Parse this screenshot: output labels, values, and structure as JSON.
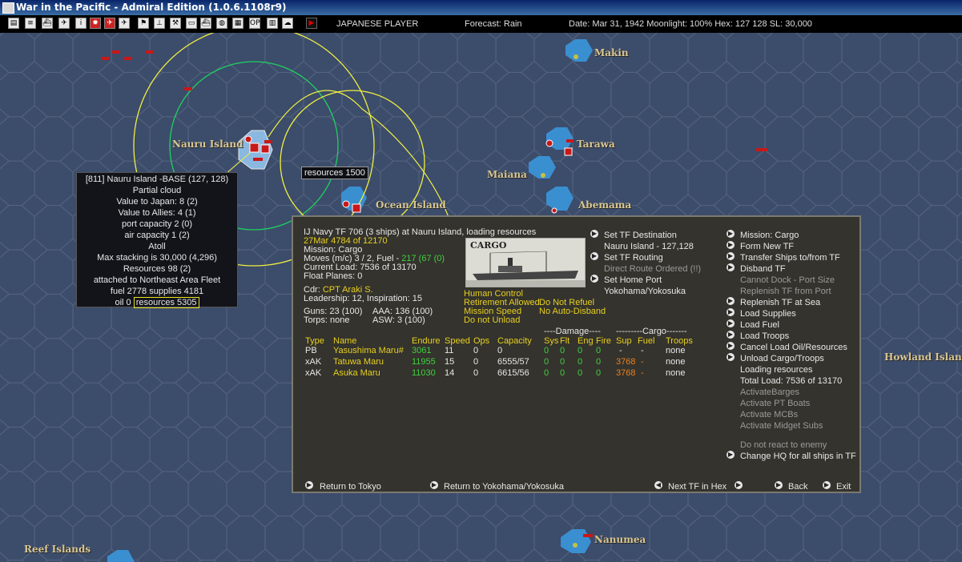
{
  "window": {
    "title": "War in the Pacific - Admiral Edition (1.0.6.1108r9)"
  },
  "toolbar": {
    "player": "JAPANESE PLAYER",
    "forecast": "Forecast: Rain",
    "status": "Date: Mar 31, 1942   Moonlight: 100%  Hex: 127 128  SL: 30,000",
    "op_label": "OP"
  },
  "map": {
    "labels": {
      "makin": "Makin",
      "nauru": "Nauru Island",
      "tarawa": "Tarawa",
      "maiana": "Maiana",
      "ocean": "Ocean Island",
      "abemama": "Abemama",
      "howland": "Howland Island",
      "nanumea": "Nanumea",
      "reef": "Reef Islands"
    },
    "tooltip": "resources 1500"
  },
  "base_popup": {
    "lines": [
      "[811] Nauru Island  -BASE  (127, 128)",
      "Partial cloud",
      "Value to Japan:  8 (2)",
      "Value to Allies:  4 (1)",
      "port capacity  2 (0)",
      "air capacity  1 (2)",
      "Atoll",
      "Max stacking is 30,000  (4,296)",
      "Resources   98 (2)",
      "attached to Northeast Area Fleet",
      "fuel 2778  supplies 4181"
    ],
    "oil": "oil 0",
    "resources": "resources 5305"
  },
  "tf_panel": {
    "header": "IJ Navy TF 706 (3 ships) at Nauru Island, loading resources",
    "date_line": "27Mar 4784 of 12170",
    "mission": "Mission: Cargo",
    "moves_prefix": "Moves (m/c)  3 / 2, Fuel - ",
    "moves_fuel": "217 (67 (0)",
    "current_load": "Current Load: 7536 of 13170",
    "float_planes": "Float Planes: 0",
    "cdr_label": "Cdr:",
    "cdr_name": "CPT Araki S.",
    "leadership": "Leadership: 12, Inspiration: 15",
    "guns": "Guns: 23 (100)",
    "aaa": "AAA: 136 (100)",
    "torps": "Torps: none",
    "asw": "ASW: 3 (100)",
    "ship_class": "CARGO",
    "status": {
      "human_control": "Human Control",
      "retirement": "Retirement Allowed",
      "no_refuel": "Do Not Refuel",
      "mission_speed": "Mission Speed",
      "no_disband": "No Auto-Disband",
      "no_unload": "Do not Unload"
    },
    "headers": {
      "damage_group": "----Damage----",
      "cargo_group": "---------Cargo-------",
      "type": "Type",
      "name": "Name",
      "endure": "Endure",
      "speed": "Speed",
      "ops": "Ops",
      "capacity": "Capacity",
      "sys": "Sys",
      "flt": "Flt",
      "eng": "Eng",
      "fire": "Fire",
      "sup": "Sup",
      "fuel": "Fuel",
      "troops": "Troops"
    },
    "ships": [
      {
        "type": "PB",
        "name": "Yasushima Maru#",
        "endure": "3061",
        "speed": "11",
        "ops": "0",
        "capacity": "0",
        "sys": "0",
        "flt": "0",
        "eng": "0",
        "fire": "0",
        "sup": "-",
        "fuel": "-",
        "troops": "none"
      },
      {
        "type": "xAK",
        "name": "Tatuwa Maru",
        "endure": "11955",
        "speed": "15",
        "ops": "0",
        "capacity": "6555/57",
        "sys": "0",
        "flt": "0",
        "eng": "0",
        "fire": "0",
        "sup": "3768",
        "fuel": "-",
        "troops": "none"
      },
      {
        "type": "xAK",
        "name": "Asuka Maru",
        "endure": "11030",
        "speed": "14",
        "ops": "0",
        "capacity": "6615/56",
        "sys": "0",
        "flt": "0",
        "eng": "0",
        "fire": "0",
        "sup": "3768",
        "fuel": "-",
        "troops": "none"
      }
    ],
    "middle": {
      "set_dest": "Set TF Destination",
      "dest_value": "Nauru Island - 127,128",
      "set_routing": "Set TF Routing",
      "routing_value": "Direct Route Ordered (!!)",
      "set_home": "Set Home Port",
      "home_value": "Yokohama/Yokosuka"
    },
    "right": {
      "mission_cargo": "Mission: Cargo",
      "form_new": "Form New TF",
      "transfer": "Transfer Ships to/from TF",
      "disband": "Disband TF",
      "cannot_dock": "Cannot Dock - Port Size",
      "replenish_port": "Replenish TF from Port",
      "replenish_sea": "Replenish TF at Sea",
      "load_supplies": "Load Supplies",
      "load_fuel": "Load Fuel",
      "load_troops": "Load Troops",
      "cancel_load": "Cancel Load Oil/Resources",
      "unload": "Unload Cargo/Troops",
      "loading": "Loading resources",
      "total_load": "Total Load: 7536 of 13170",
      "barges": "ActivateBarges",
      "pt_boats": "Activate PT Boats",
      "mcbs": "Activate MCBs",
      "midget": "Activate Midget Subs",
      "no_react": "Do not react to enemy",
      "change_hq": "Change HQ for all ships in TF"
    },
    "bottom": {
      "return_tokyo": "Return to Tokyo",
      "return_yoko": "Return to Yokohama/Yokosuka",
      "next_tf": "Next TF in Hex",
      "back": "Back",
      "exit": "Exit"
    }
  },
  "colors": {
    "ocean": "#3c4c6b",
    "hex_line": "#56667f",
    "range": "#f0f040",
    "range_inner": "#20d060",
    "island_hex": "#3a8fd0",
    "text_yellow": "#e8d020",
    "text_green": "#40d040",
    "text_orange": "#e88020"
  }
}
